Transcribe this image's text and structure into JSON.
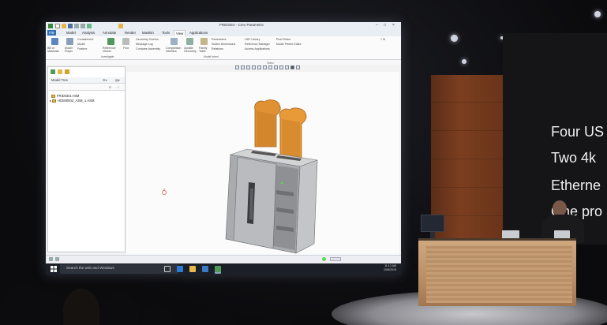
{
  "app": {
    "window_title": "FRIDGE4 - Creo Parametric",
    "tabs": [
      "File",
      "Model",
      "Analysis",
      "Annotate",
      "Render",
      "Manikin",
      "Tools",
      "View",
      "Applications"
    ],
    "active_tab": "View"
  },
  "ribbon": {
    "items": [
      {
        "label": "Bill of Materials"
      },
      {
        "label": "Model Player"
      },
      {
        "label": "Find"
      },
      {
        "label": "Distance Tool"
      },
      {
        "label": "Reference Viewer"
      },
      {
        "label": "Geometry Checks"
      },
      {
        "label": "Message Log"
      },
      {
        "label": "Compare Assembly"
      },
      {
        "label": "Comparison Interface"
      },
      {
        "label": "Update Geometry"
      },
      {
        "label": "Family Table"
      },
      {
        "label": "Parameters"
      },
      {
        "label": "Switch Dimensions"
      },
      {
        "label": "Relations"
      },
      {
        "label": "UDF Library"
      },
      {
        "label": "Reference Manager"
      },
      {
        "label": "Access Applications"
      },
      {
        "label": "Pixel Editor"
      },
      {
        "label": "Model Printer Editor"
      },
      {
        "label": "Containment"
      },
      {
        "label": "Model"
      },
      {
        "label": "Feature"
      }
    ],
    "groups": [
      "Investigate",
      "Model Intent"
    ]
  },
  "graphics_toolbar_label": "Video",
  "model_tree": {
    "title": "Model Tree",
    "rows": [
      "FRIDGE4.ASM",
      "HDMI0002_ASM_1.ASM"
    ]
  },
  "taskbar": {
    "search_placeholder": "Search the web and Windows",
    "time": "11:12 AM",
    "date": "10/6/2015"
  },
  "slide": {
    "lines": [
      "Four US",
      "Two 4k",
      "Etherne",
      "One pro"
    ]
  },
  "colors": {
    "accent": "#2f6fb5",
    "toast": "#e2912a",
    "toaster_body": "#b7b8ba",
    "taskbar": "#1b1f27"
  }
}
